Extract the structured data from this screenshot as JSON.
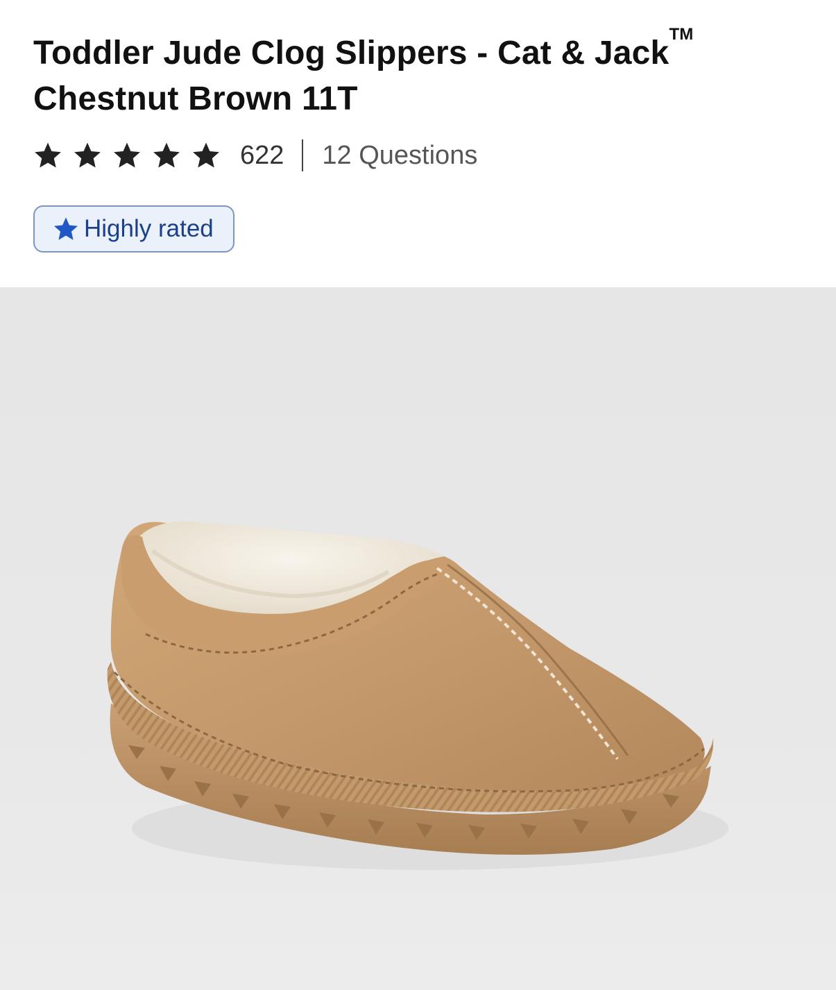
{
  "product": {
    "title_line1": "Toddler Jude Clog Slippers - Cat & Jack",
    "trademark": "TM",
    "title_line2": "Chestnut Brown 11T"
  },
  "rating": {
    "stars": 5,
    "star_icon": "star-icon",
    "review_count": "622",
    "questions_label": "12 Questions"
  },
  "badge": {
    "icon": "star-icon",
    "label": "Highly rated",
    "color": "#1b3f8b",
    "background": "#eaf1fb"
  },
  "colors": {
    "star": "#222222",
    "slipper": "#c49a6c",
    "image_background": "#e8e8e8"
  }
}
